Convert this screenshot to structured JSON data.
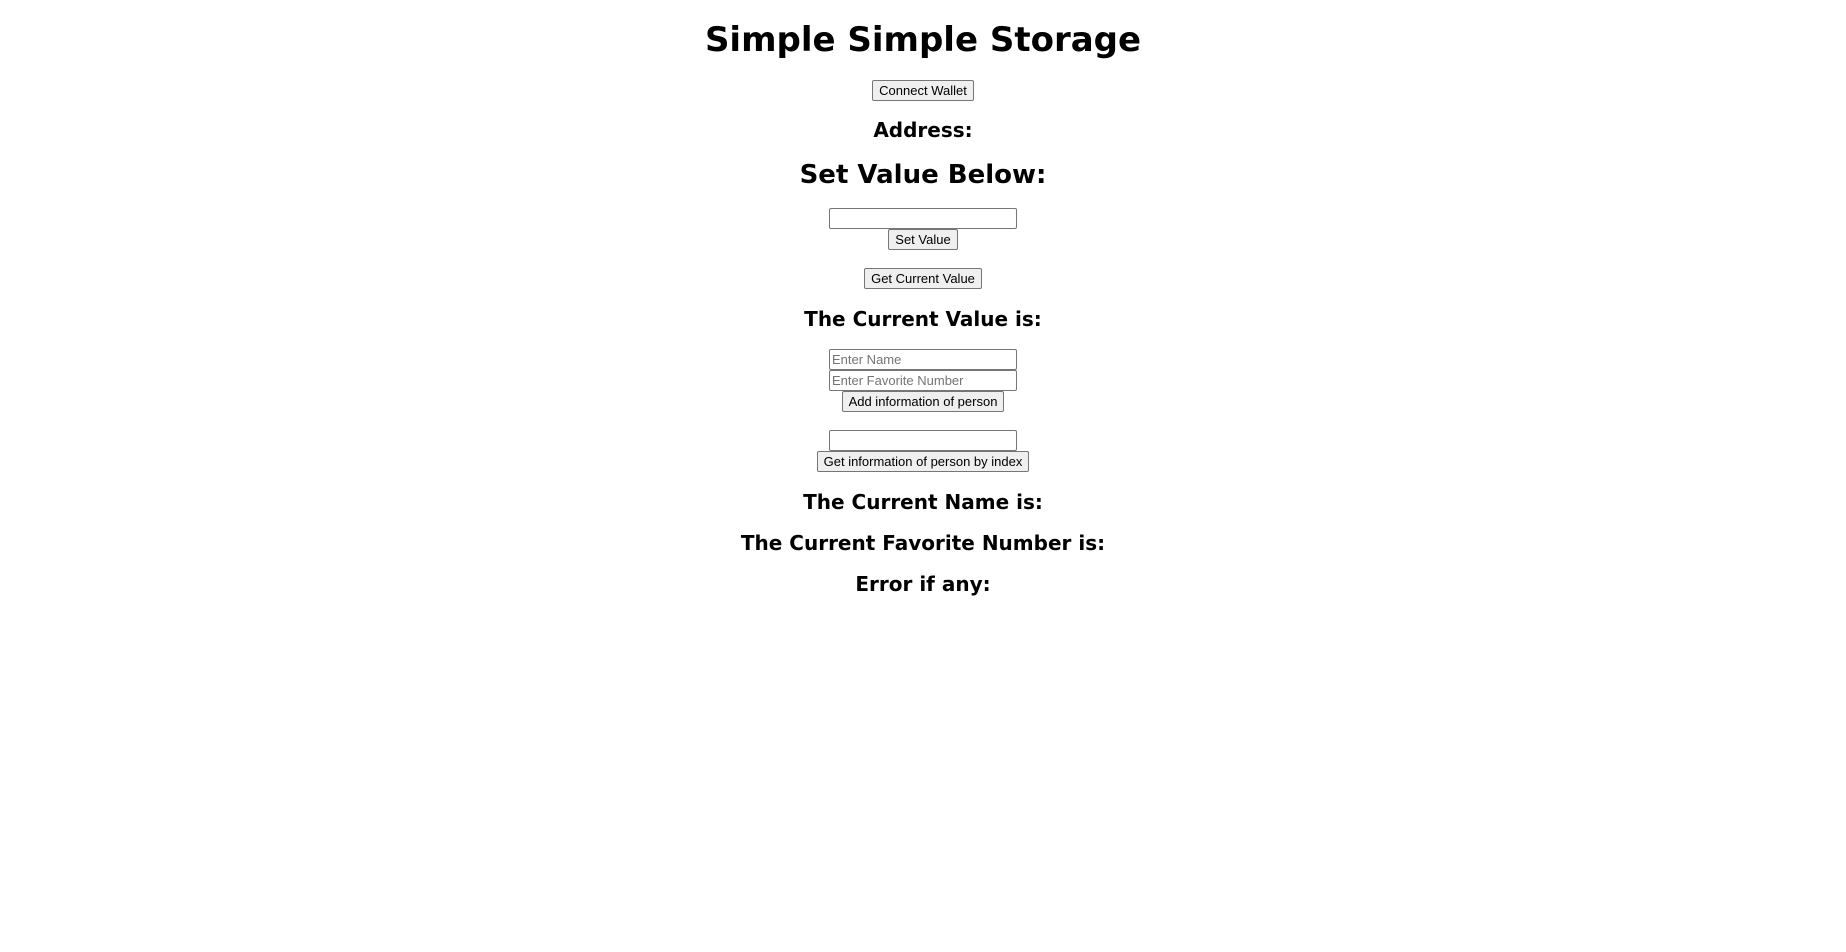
{
  "page": {
    "title": "Simple Simple Storage",
    "connect_wallet_label": "Connect Wallet",
    "address_label": "Address:",
    "set_value_heading": "Set Value Below:",
    "set_value_input": {
      "value": "",
      "placeholder": ""
    },
    "set_value_button": "Set Value",
    "get_current_value_button": "Get Current Value",
    "current_value_label": "The Current Value is:",
    "name_input": {
      "value": "",
      "placeholder": "Enter Name"
    },
    "favorite_number_input": {
      "value": "",
      "placeholder": "Enter Favorite Number"
    },
    "add_person_button": "Add information of person",
    "index_input": {
      "value": "",
      "placeholder": ""
    },
    "get_person_button": "Get information of person by index",
    "current_name_label": "The Current Name is:",
    "current_favorite_number_label": "The Current Favorite Number is:",
    "error_label": "Error if any:"
  }
}
